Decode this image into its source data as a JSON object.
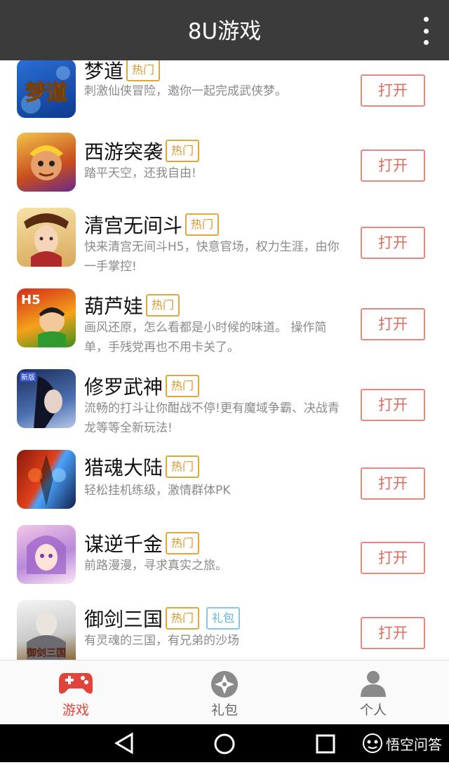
{
  "app_bar": {
    "title": "8U游戏",
    "menu_icon": "more-vertical-icon"
  },
  "games": [
    {
      "name": "梦道",
      "badges": [
        "热门"
      ],
      "desc": "刺激仙侠冒险，邀你一起完成武侠梦。",
      "button": "打开",
      "icon_text": "梦道"
    },
    {
      "name": "西游突袭",
      "badges": [
        "热门"
      ],
      "desc": "踏平天空，还我自由!",
      "button": "打开"
    },
    {
      "name": "清宫无间斗",
      "badges": [
        "热门"
      ],
      "desc": "快来清宫无间斗H5，快意官场，权力生涯，由你一手掌控!",
      "button": "打开"
    },
    {
      "name": "葫芦娃",
      "badges": [
        "热门"
      ],
      "desc": "画风还原，怎么看都是小时候的味道。 操作简单，手残党再也不用卡关了。",
      "button": "打开",
      "icon_text": "H5"
    },
    {
      "name": "修罗武神",
      "badges": [
        "热门"
      ],
      "desc": "流畅的打斗让你酣战不停!更有魔域争霸、决战青龙等等全新玩法!",
      "button": "打开",
      "icon_text": "新版"
    },
    {
      "name": "猎魂大陆",
      "badges": [
        "热门"
      ],
      "desc": "轻松挂机练级，激情群体PK",
      "button": "打开"
    },
    {
      "name": "谋逆千金",
      "badges": [
        "热门"
      ],
      "desc": "前路漫漫，寻求真实之旅。",
      "button": "打开"
    },
    {
      "name": "御剑三国",
      "badges": [
        "热门",
        "礼包"
      ],
      "desc": "有灵魂的三国，有兄弟的沙场",
      "button": "打开",
      "icon_text": "御剑三国"
    }
  ],
  "tabs": [
    {
      "label": "游戏",
      "icon": "gamepad-icon",
      "active": true
    },
    {
      "label": "礼包",
      "icon": "gift-shuriken-icon",
      "active": false
    },
    {
      "label": "个人",
      "icon": "person-icon",
      "active": false
    }
  ],
  "system_nav": {
    "back_icon": "back-triangle-icon",
    "home_icon": "home-circle-icon",
    "recents_icon": "recents-square-icon"
  },
  "watermark": {
    "text": "悟空问答"
  },
  "colors": {
    "appbar": "#3b3b3b",
    "hot_badge": "#e0a83a",
    "gift_badge": "#7fc9ea",
    "open_button": "#de6b5c",
    "active_tab": "#e0443a"
  }
}
